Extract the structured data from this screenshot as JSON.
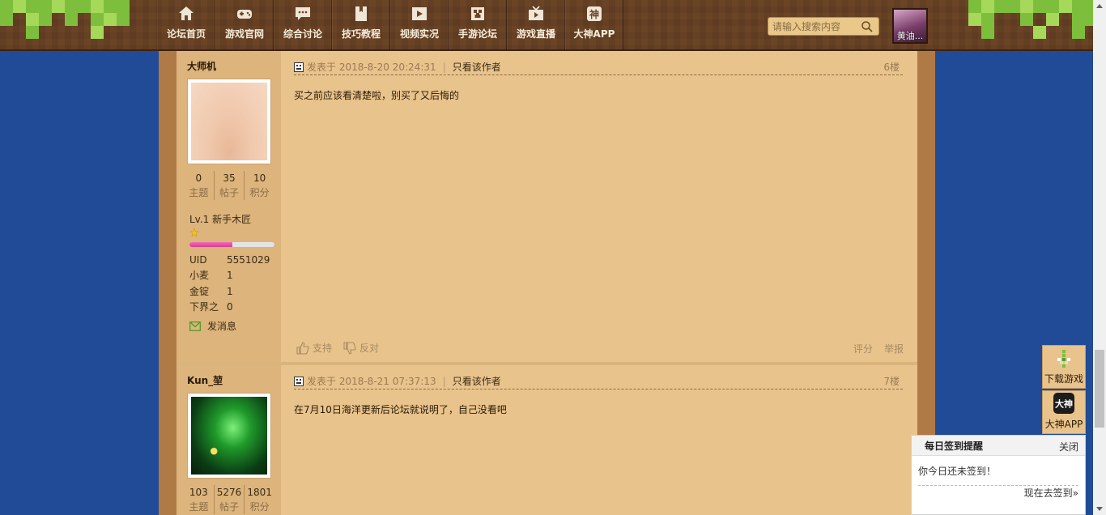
{
  "nav": {
    "items": [
      {
        "label": "论坛首页",
        "icon": "home-icon"
      },
      {
        "label": "游戏官网",
        "icon": "gamepad-icon"
      },
      {
        "label": "综合讨论",
        "icon": "chat-icon"
      },
      {
        "label": "技巧教程",
        "icon": "book-icon"
      },
      {
        "label": "视频实况",
        "icon": "video-icon"
      },
      {
        "label": "手游论坛",
        "icon": "creeper-icon"
      },
      {
        "label": "游戏直播",
        "icon": "tv-icon"
      },
      {
        "label": "大神APP",
        "icon": "shen-icon"
      }
    ],
    "search_placeholder": "请输入搜索内容",
    "user_name": "黄油..."
  },
  "posts": [
    {
      "author": "大师机",
      "avatar": "chest-photo",
      "stats": [
        {
          "n": "0",
          "l": "主题"
        },
        {
          "n": "35",
          "l": "帖子"
        },
        {
          "n": "10",
          "l": "积分"
        }
      ],
      "rank": "Lv.1 新手木匠",
      "level_progress": 0.5,
      "info": [
        {
          "k": "UID",
          "v": "5551029"
        },
        {
          "k": "小麦",
          "v": "1"
        },
        {
          "k": "金锭",
          "v": "1"
        },
        {
          "k": "下界之",
          "v": "0"
        }
      ],
      "send_msg": "发消息",
      "time": "发表于 2018-8-20 20:24:31",
      "only_author": "只看该作者",
      "floor": "6楼",
      "body": "买之前应该看清楚啦，别买了又后悔的",
      "support": "支持",
      "oppose": "反对",
      "rate": "评分",
      "report": "举报"
    },
    {
      "author": "Kun_堃",
      "avatar": "minecraft-scene",
      "stats": [
        {
          "n": "103",
          "l": "主题"
        },
        {
          "n": "5276",
          "l": "帖子"
        },
        {
          "n": "1801",
          "l": "积分"
        }
      ],
      "time": "发表于 2018-8-21 07:37:13",
      "only_author": "只看该作者",
      "floor": "7楼",
      "body": "在7月10日海洋更新后论坛就说明了，自己没看吧"
    }
  ],
  "float": {
    "download": "下载游戏",
    "app": "大神APP"
  },
  "signin": {
    "title": "每日签到提醒",
    "close": "关闭",
    "text": "你今日还未签到！",
    "go": "现在去签到»"
  },
  "colors": {
    "background": "#214b96",
    "header": "#6b4426",
    "panel": "#e9c38c",
    "sidebar": "#dcb47c",
    "grass": "#7dbf3c"
  }
}
